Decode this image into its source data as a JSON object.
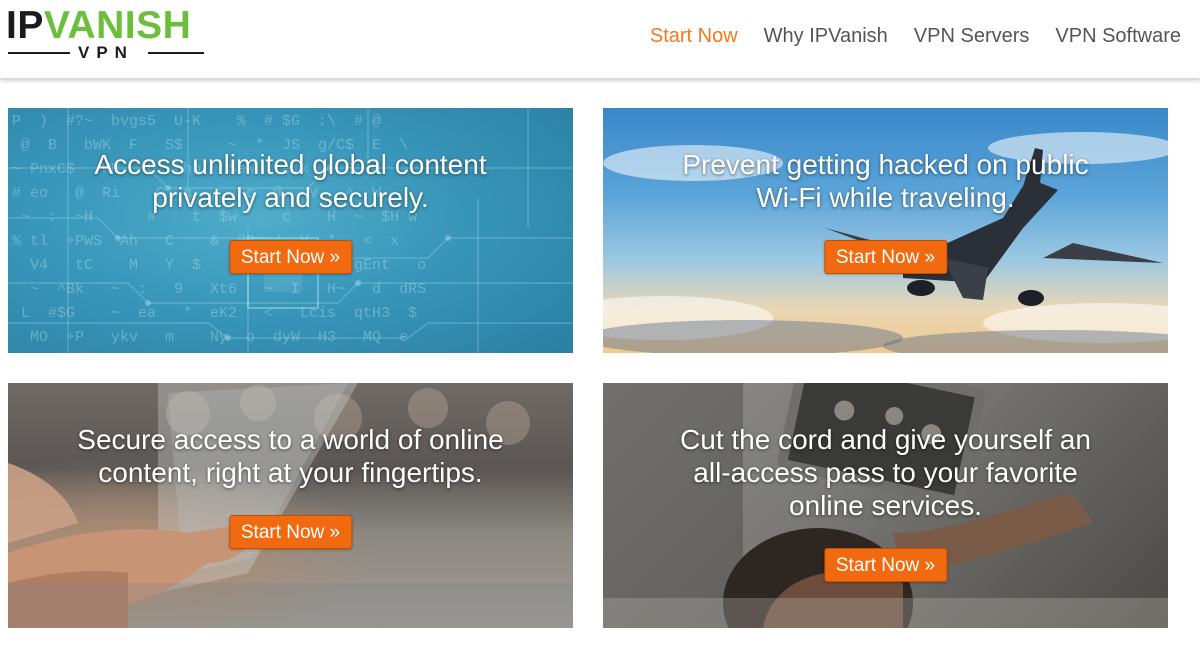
{
  "brand": {
    "logo_primary": "IP",
    "logo_accent": "VANISH",
    "logo_sub": "VPN",
    "primary_color": "#1b1b1b",
    "accent_color": "#6bbf3a"
  },
  "nav": {
    "items": [
      {
        "label": "Start Now",
        "active": true
      },
      {
        "label": "Why IPVanish",
        "active": false
      },
      {
        "label": "VPN Servers",
        "active": false
      },
      {
        "label": "VPN Software",
        "active": false
      }
    ],
    "active_color": "#f07921"
  },
  "tiles": [
    {
      "headline": "Access unlimited global content\nprivately and securely.",
      "cta": "Start Now »",
      "background": "blue circuit board with code characters"
    },
    {
      "headline": "Prevent getting hacked on public\nWi-Fi while traveling.",
      "cta": "Start Now »",
      "background": "airplane flying in sky at sunset"
    },
    {
      "headline": "Secure access to a world of online\ncontent, right at your fingertips.",
      "cta": "Start Now »",
      "background": "hand holding smartphone in crowd"
    },
    {
      "headline": "Cut the cord and give yourself an\nall-access pass to your favorite\nonline services.",
      "cta": "Start Now »",
      "background": "person watching tablet on couch"
    }
  ],
  "cta_color": "#f26a10"
}
